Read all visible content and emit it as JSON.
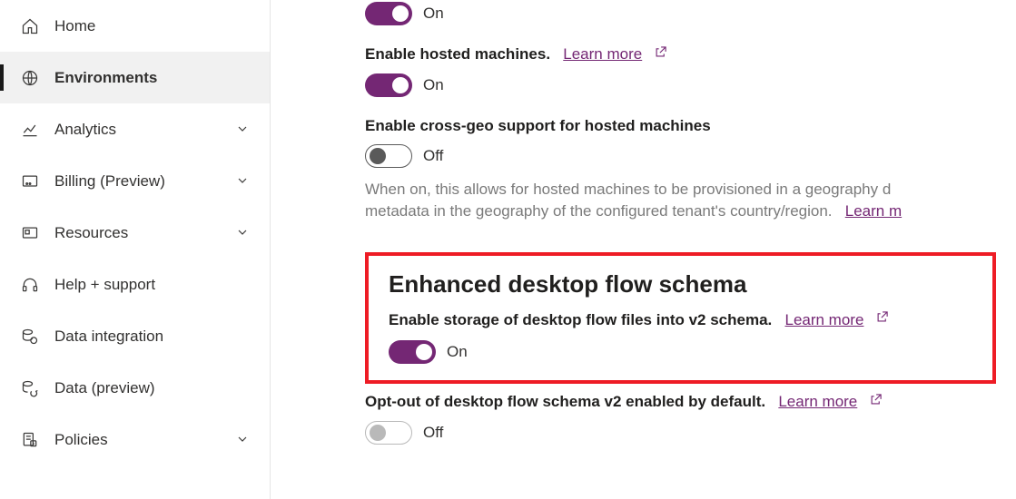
{
  "colors": {
    "accent": "#742774",
    "highlight_border": "#ee1c25"
  },
  "sidebar": {
    "items": [
      {
        "label": "Home",
        "has_chevron": false,
        "active": false
      },
      {
        "label": "Environments",
        "has_chevron": false,
        "active": true
      },
      {
        "label": "Analytics",
        "has_chevron": true,
        "active": false
      },
      {
        "label": "Billing (Preview)",
        "has_chevron": true,
        "active": false
      },
      {
        "label": "Resources",
        "has_chevron": true,
        "active": false
      },
      {
        "label": "Help + support",
        "has_chevron": false,
        "active": false
      },
      {
        "label": "Data integration",
        "has_chevron": false,
        "active": false
      },
      {
        "label": "Data (preview)",
        "has_chevron": false,
        "active": false
      },
      {
        "label": "Policies",
        "has_chevron": true,
        "active": false
      }
    ]
  },
  "main": {
    "toggle0_state": "On",
    "hosted_label": "Enable hosted machines.",
    "hosted_link": "Learn more",
    "hosted_state": "On",
    "crossgeo_label": "Enable cross-geo support for hosted machines",
    "crossgeo_state": "Off",
    "crossgeo_desc_a": "When on, this allows for hosted machines to be provisioned in a geography d",
    "crossgeo_desc_b": "metadata in the geography of the configured tenant's country/region.",
    "crossgeo_desc_link": "Learn m",
    "section_title": "Enhanced desktop flow schema",
    "v2_label": "Enable storage of desktop flow files into v2 schema.",
    "v2_link": "Learn more",
    "v2_state": "On",
    "optout_label": "Opt-out of desktop flow schema v2 enabled by default.",
    "optout_link": "Learn more",
    "optout_state": "Off"
  }
}
